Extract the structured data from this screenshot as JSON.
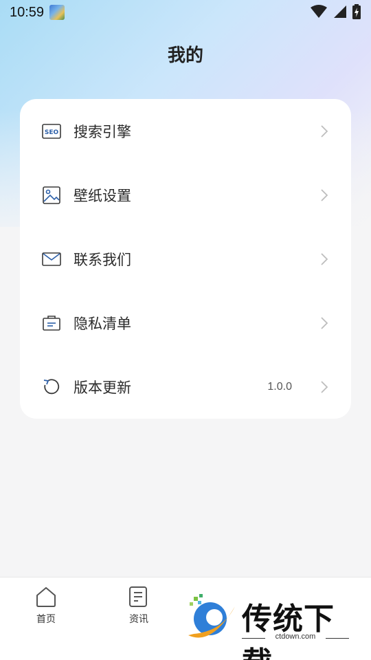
{
  "status_bar": {
    "time": "10:59"
  },
  "header": {
    "title": "我的"
  },
  "menu": {
    "items": [
      {
        "label": "搜索引擎",
        "icon": "seo-icon",
        "value": ""
      },
      {
        "label": "壁纸设置",
        "icon": "image-icon",
        "value": ""
      },
      {
        "label": "联系我们",
        "icon": "mail-icon",
        "value": ""
      },
      {
        "label": "隐私清单",
        "icon": "privacy-list-icon",
        "value": ""
      },
      {
        "label": "版本更新",
        "icon": "refresh-icon",
        "value": "1.0.0"
      }
    ]
  },
  "bottom_nav": {
    "tabs": [
      {
        "label": "首页",
        "icon": "home-icon"
      },
      {
        "label": "资讯",
        "icon": "news-icon"
      }
    ]
  },
  "watermark": {
    "title": "传统下载",
    "url": "ctdown.com"
  },
  "colors": {
    "icon_blue": "#2c5fa8",
    "icon_dark": "#3a3a3a",
    "card_bg": "#ffffff",
    "page_bg": "#f5f5f6"
  }
}
